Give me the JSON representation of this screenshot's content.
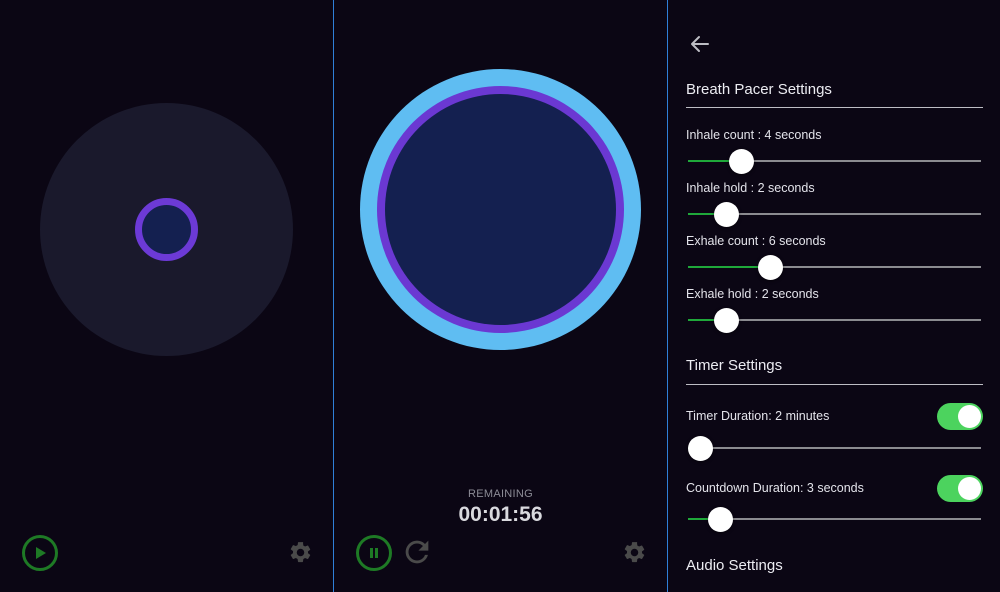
{
  "idle_screen": {
    "play_icon": "play-icon",
    "settings_icon": "gear-icon"
  },
  "session_screen": {
    "remaining_label": "REMAINING",
    "remaining_time": "00:01:56",
    "pause_icon": "pause-icon",
    "restart_icon": "restart-icon",
    "settings_icon": "gear-icon"
  },
  "settings_screen": {
    "back_icon": "arrow-left-icon",
    "breath_section_title": "Breath Pacer Settings",
    "sliders": {
      "inhale_count": {
        "label": "Inhale count : 4 seconds",
        "fraction": 0.18
      },
      "inhale_hold": {
        "label": "Inhale hold : 2 seconds",
        "fraction": 0.13
      },
      "exhale_count": {
        "label": "Exhale count : 6 seconds",
        "fraction": 0.28
      },
      "exhale_hold": {
        "label": "Exhale hold : 2 seconds",
        "fraction": 0.13
      }
    },
    "timer_section_title": "Timer Settings",
    "timer_duration": {
      "label": "Timer Duration: 2 minutes",
      "enabled": true,
      "fraction": 0.03
    },
    "countdown_duration": {
      "label": "Countdown Duration: 3 seconds",
      "enabled": true,
      "fraction": 0.11
    },
    "audio_section_title": "Audio Settings"
  },
  "colors": {
    "background": "#0b0614",
    "idle_disc": "#1a192c",
    "ring_purple": "#6b38d2",
    "ring_blue": "#5fbdf2",
    "core_navy": "#142050",
    "control_green": "#1e7a25",
    "toggle_on": "#4cd35e",
    "slider_fill": "#1fa83a",
    "divider": "#2f7fd8"
  }
}
